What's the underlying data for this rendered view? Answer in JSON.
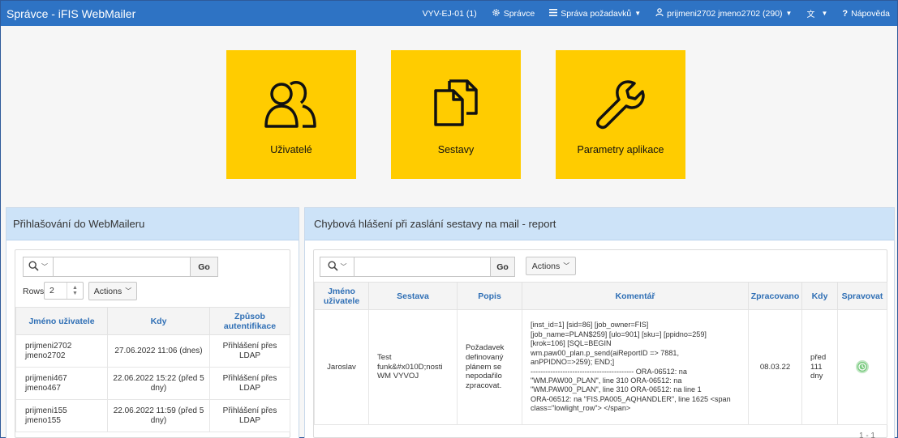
{
  "header": {
    "app_title": "Správce - iFIS WebMailer",
    "env": "VYV-EJ-01 (1)",
    "admin": "Správce",
    "requests": "Správa požadavků",
    "user": "prijmeni2702 jmeno2702 (290)",
    "help": "Nápověda",
    "accent": "#2e73c4"
  },
  "tiles": {
    "users": "Uživatelé",
    "reports": "Sestavy",
    "params": "Parametry aplikace",
    "color": "#ffcc00"
  },
  "login_region": {
    "title": "Přihlašování do WebMaileru",
    "go": "Go",
    "rows_label": "Rows",
    "rows_value": "2",
    "actions": "Actions",
    "columns": [
      "Jméno uživatele",
      "Kdy",
      "Způsob autentifikace"
    ],
    "rows": [
      {
        "name_line1": "prijmeni2702",
        "name_line2": "jmeno2702",
        "when_line1": "27.06.2022 11:06 (dnes)",
        "when_line2": "",
        "auth_line1": "Přihlášení přes",
        "auth_line2": "LDAP"
      },
      {
        "name_line1": "prijmeni467",
        "name_line2": "jmeno467",
        "when_line1": "22.06.2022 15:22 (před 5",
        "when_line2": "dny)",
        "auth_line1": "Přihlášení přes",
        "auth_line2": "LDAP"
      },
      {
        "name_line1": "prijmeni155",
        "name_line2": "jmeno155",
        "when_line1": "22.06.2022 11:59 (před 5",
        "when_line2": "dny)",
        "auth_line1": "Přihlášení přes",
        "auth_line2": "LDAP"
      }
    ]
  },
  "error_region": {
    "title": "Chybová hlášení při zaslání sestavy na mail - report",
    "go": "Go",
    "actions": "Actions",
    "columns": [
      "Jméno uživatele",
      "Sestava",
      "Popis",
      "Komentář",
      "Zpracovano",
      "Kdy",
      "Spravovat"
    ],
    "row": {
      "user": "Jaroslav",
      "report_lines": [
        "Test",
        "funk&#x010D;nosti",
        "WM VYVOJ"
      ],
      "description_lines": [
        "Požadavek",
        "definovaný",
        "plánem se",
        "nepodařilo",
        "zpracovat."
      ],
      "comment_lines": [
        "[inst_id=1] [sid=86] [job_owner=FIS]",
        "[job_name=PLAN$259] [ulo=901] [sku=] [ppidno=259]",
        "[krok=106] [SQL=BEGIN",
        "wm.paw00_plan.p_send(aiReportID => 7881,",
        "anPPIDNO=>259); END;]",
        "------------------------------------------ ORA-06512: na",
        "\"WM.PAW00_PLAN\", line 310 ORA-06512: na",
        "\"WM.PAW00_PLAN\", line 310 ORA-06512: na line 1",
        "ORA-06512: na \"FIS.PA005_AQHANDLER\", line 1625 <span",
        "class=\"lowlight_row\"> </span>"
      ],
      "processed": "08.03.22",
      "when_lines": [
        "před",
        "111",
        "dny"
      ]
    },
    "pagination": "1 - 1"
  }
}
